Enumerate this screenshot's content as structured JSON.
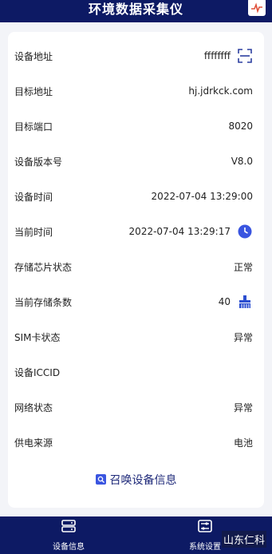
{
  "header": {
    "title": "环境数据采集仪",
    "icon": "chart-pulse-icon"
  },
  "rows": [
    {
      "label": "设备地址",
      "value": "ffffffff",
      "icon": "scan-icon"
    },
    {
      "label": "目标地址",
      "value": "hj.jdrkck.com"
    },
    {
      "label": "目标端口",
      "value": "8020"
    },
    {
      "label": "设备版本号",
      "value": "V8.0"
    },
    {
      "label": "设备时间",
      "value": "2022-07-04 13:29:00"
    },
    {
      "label": "当前时间",
      "value": "2022-07-04 13:29:17",
      "icon": "clock-icon"
    },
    {
      "label": "存储芯片状态",
      "value": "正常"
    },
    {
      "label": "当前存储条数",
      "value": "40",
      "icon": "clear-brush-icon"
    },
    {
      "label": "SIM卡状态",
      "value": "异常"
    },
    {
      "label": "设备ICCID",
      "value": ""
    },
    {
      "label": "网络状态",
      "value": "异常"
    },
    {
      "label": "供电来源",
      "value": "电池"
    }
  ],
  "recall_button": {
    "label": "召唤设备信息",
    "icon": "search-doc-icon"
  },
  "tabbar": {
    "tabs": [
      {
        "label": "设备信息",
        "icon": "device-info-icon"
      },
      {
        "label": "系统设置",
        "icon": "settings-sliders-icon"
      }
    ]
  },
  "watermark": "山东仁科",
  "colors": {
    "primary": "#0d1a64",
    "accent": "#3a55e0",
    "background": "#f3f4f8"
  }
}
